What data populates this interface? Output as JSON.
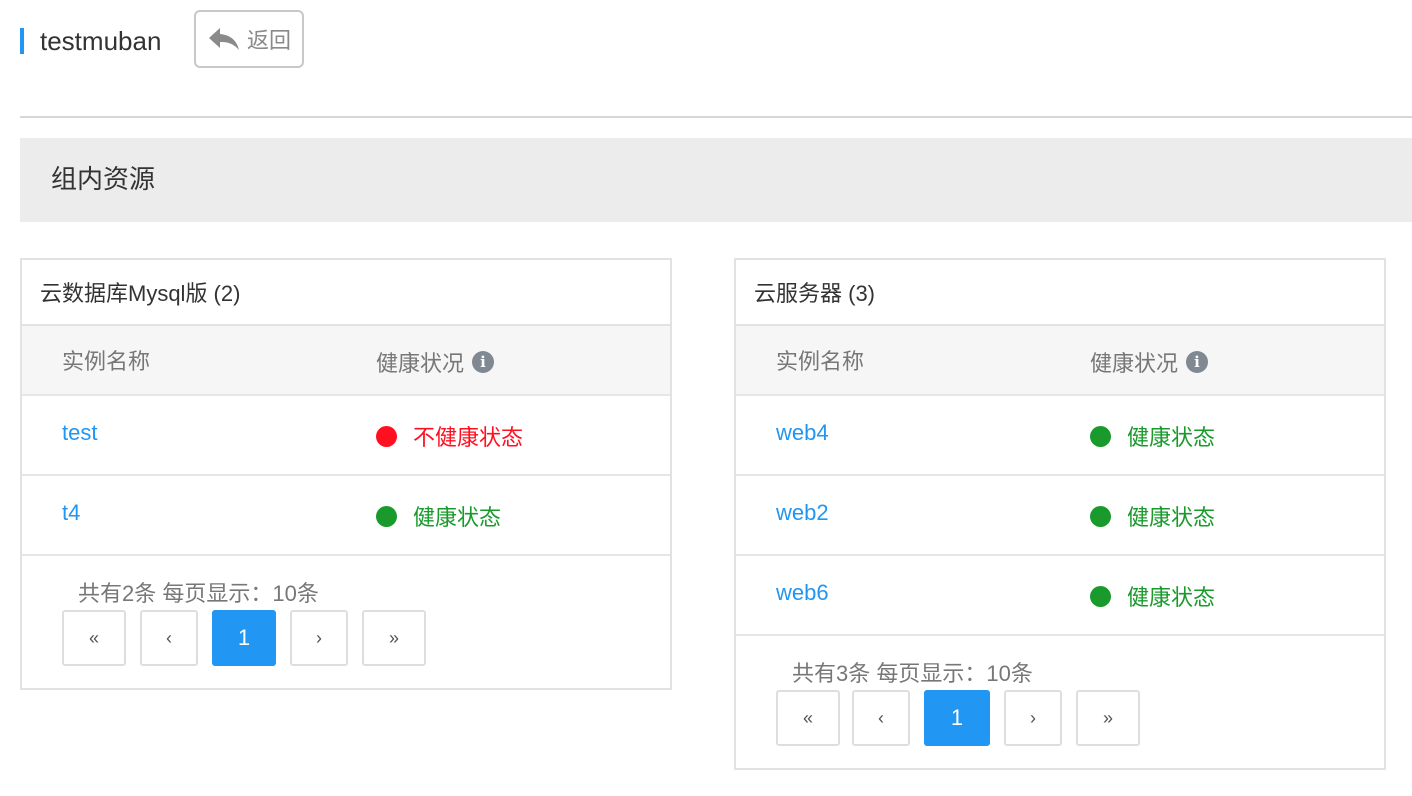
{
  "header": {
    "title": "testmuban",
    "back_label": "返回"
  },
  "section": {
    "title": "组内资源"
  },
  "cards": [
    {
      "title": "云数据库Mysql版 (2)",
      "columns": {
        "name": "实例名称",
        "health": "健康状况"
      },
      "rows": [
        {
          "name": "test",
          "status": "不健康状态",
          "healthy": false
        },
        {
          "name": "t4",
          "status": "健康状态",
          "healthy": true
        }
      ],
      "pager": {
        "summary": "共有2条 每页显示：10条",
        "first": "«",
        "prev": "‹",
        "current": "1",
        "next": "›",
        "last": "»"
      }
    },
    {
      "title": "云服务器 (3)",
      "columns": {
        "name": "实例名称",
        "health": "健康状况"
      },
      "rows": [
        {
          "name": "web4",
          "status": "健康状态",
          "healthy": true
        },
        {
          "name": "web2",
          "status": "健康状态",
          "healthy": true
        },
        {
          "name": "web6",
          "status": "健康状态",
          "healthy": true
        }
      ],
      "pager": {
        "summary": "共有3条 每页显示：10条",
        "first": "«",
        "prev": "‹",
        "current": "1",
        "next": "›",
        "last": "»"
      }
    }
  ],
  "colors": {
    "accent": "#2196f3",
    "healthy": "#1a9a2c",
    "unhealthy": "#ff1020"
  },
  "icons": {
    "back": "reply-arrow-icon",
    "info": "info-icon"
  }
}
